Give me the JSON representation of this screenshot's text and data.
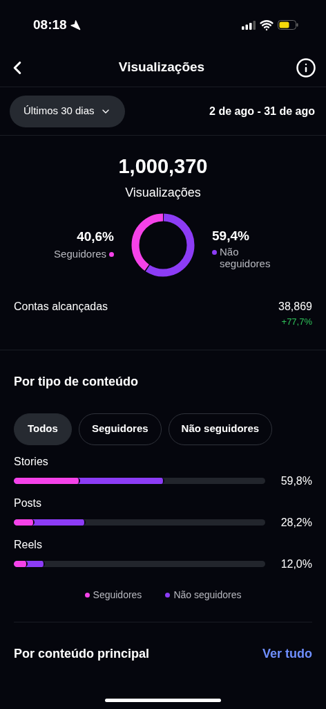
{
  "status_bar": {
    "time": "08:18"
  },
  "header": {
    "title": "Visualizações"
  },
  "filter": {
    "period": "Últimos 30 dias",
    "range": "2 de ago - 31 de ago"
  },
  "summary": {
    "total": "1,000,370",
    "label": "Visualizações",
    "breakdown": [
      {
        "value": "40,6%",
        "label": "Seguidores",
        "color": "#f542e8",
        "level": 0.406
      },
      {
        "value": "59,4%",
        "label": "Não seguidores",
        "color": "#8c3cf5",
        "level": 0.594
      }
    ]
  },
  "reach": {
    "label": "Contas alcançadas",
    "value": "38,869",
    "change": "+77,7%"
  },
  "content_type": {
    "title": "Por tipo de conteúdo",
    "tabs": [
      {
        "label": "Todos",
        "selected": true
      },
      {
        "label": "Seguidores",
        "selected": false
      },
      {
        "label": "Não seguidores",
        "selected": false
      }
    ],
    "rows": [
      {
        "label": "Stories",
        "reading": "59,8%",
        "segments": [
          {
            "level": 0.264,
            "color": "#f542e8"
          },
          {
            "level": 0.6,
            "color": "#8c3cf5"
          }
        ]
      },
      {
        "label": "Posts",
        "reading": "28,2%",
        "segments": [
          {
            "level": 0.083,
            "color": "#f542e8"
          },
          {
            "level": 0.286,
            "color": "#8c3cf5"
          }
        ]
      },
      {
        "label": "Reels",
        "reading": "12,0%",
        "segments": [
          {
            "level": 0.055,
            "color": "#f542e8"
          },
          {
            "level": 0.124,
            "color": "#8c3cf5"
          }
        ]
      }
    ],
    "legend": [
      {
        "label": "Seguidores",
        "color": "#f542e8"
      },
      {
        "label": "Não seguidores",
        "color": "#8c3cf5"
      }
    ]
  },
  "top_content": {
    "title": "Por conteúdo principal",
    "link": "Ver tudo"
  }
}
